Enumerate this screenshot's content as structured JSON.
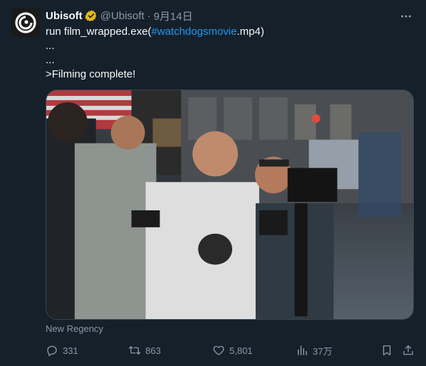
{
  "author": {
    "name": "Ubisoft",
    "handle": "@Ubisoft",
    "separator": "·",
    "date": "9月14日"
  },
  "tweet": {
    "line1_prefix": "run film_wrapped.exe(",
    "line1_hashtag": "#watchdogsmovie",
    "line1_suffix": ".mp4)",
    "line2": "...",
    "line3": "...",
    "line4": ">Filming complete!"
  },
  "media": {
    "credit": "New Regency"
  },
  "actions": {
    "replies": "331",
    "retweets": "863",
    "likes": "5,801",
    "views": "37万"
  },
  "colors": {
    "background": "#15202b",
    "accent": "#1d9bf0",
    "muted": "#8b98a5",
    "verified": "#e2b719"
  }
}
